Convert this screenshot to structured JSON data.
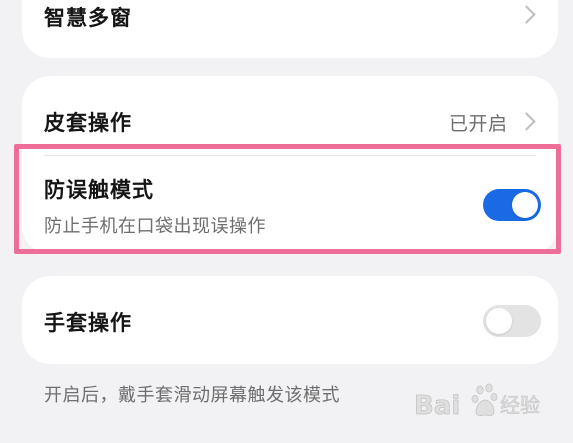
{
  "settings": {
    "smart_multiwindow": {
      "label": "智慧多窗"
    },
    "cover_operation": {
      "label": "皮套操作",
      "status": "已开启"
    },
    "anti_mistouch": {
      "label": "防误触模式",
      "description": "防止手机在口袋出现误操作",
      "enabled": true
    },
    "glove_operation": {
      "label": "手套操作",
      "enabled": false,
      "footnote": "开启后，戴手套滑动屏幕触发该模式"
    }
  },
  "watermark": {
    "brand": "Bai",
    "suffix": "经验",
    "logo": "paw-logo"
  },
  "colors": {
    "background": "#f2f2f4",
    "card": "#ffffff",
    "toggle_on": "#1a6ae6",
    "toggle_off": "#e3e3e3",
    "highlight": "#ef6e97"
  }
}
